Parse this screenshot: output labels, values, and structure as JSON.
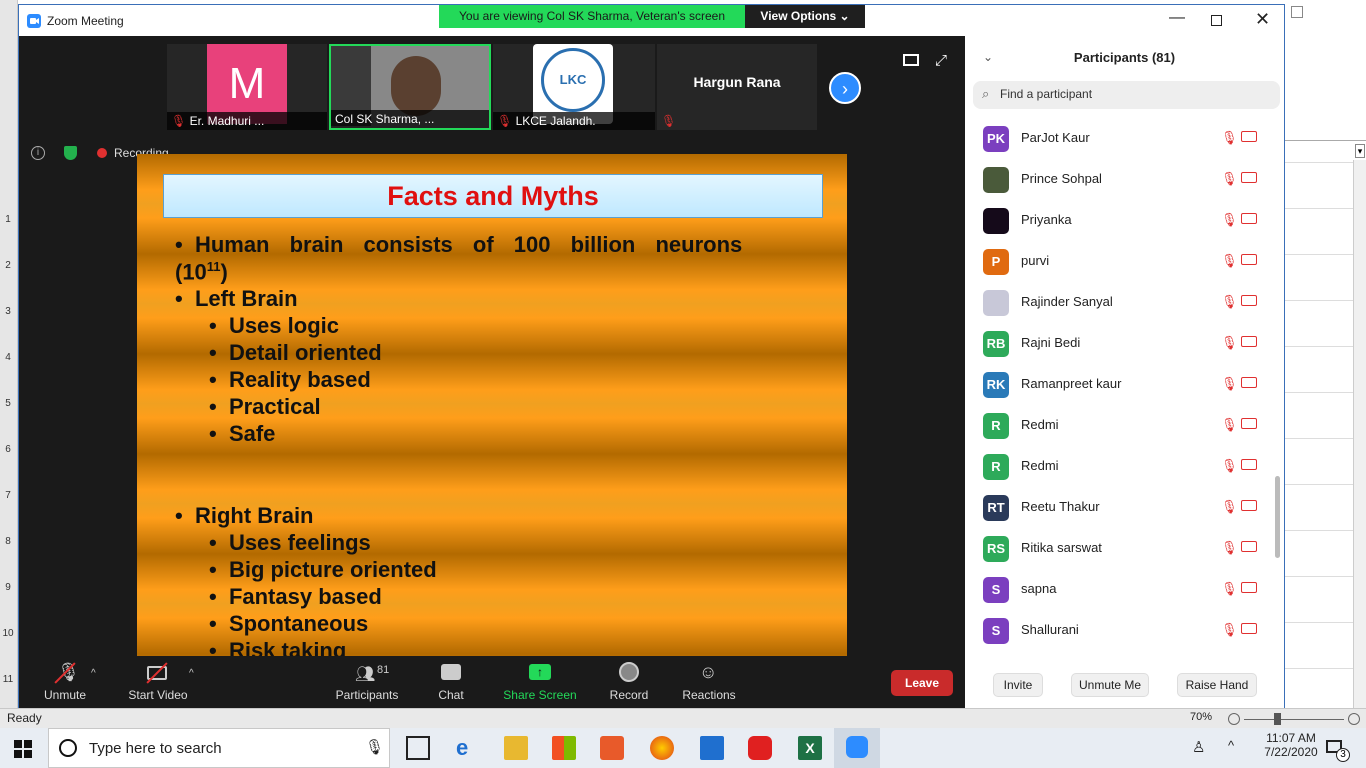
{
  "window": {
    "title": "Zoom Meeting"
  },
  "banner": {
    "text": "You are viewing Col SK Sharma, Veteran's screen",
    "view_options": "View Options"
  },
  "thumbnails": [
    {
      "label": "Er. Madhuri ...",
      "initial": "M"
    },
    {
      "label": "Col SK Sharma, ..."
    },
    {
      "label": "LKCE Jalandh.",
      "logo_text": "LKC"
    },
    {
      "label": "Hargun Rana"
    }
  ],
  "recording": {
    "text": "Recording"
  },
  "slide": {
    "title": "Facts and Myths",
    "line1": "Human brain consists of 100 billion neurons",
    "line1b": "(10",
    "line1_sup": "11",
    "line1_end": ")",
    "left_heading": "Left Brain",
    "left_items": [
      "Uses logic",
      "Detail oriented",
      "Reality based",
      "Practical",
      "Safe"
    ],
    "right_heading": "Right Brain",
    "right_items": [
      "Uses feelings",
      "Big picture oriented",
      "Fantasy based",
      "Spontaneous",
      "Risk taking"
    ]
  },
  "toolbar": {
    "unmute": "Unmute",
    "start_video": "Start Video",
    "participants": "Participants",
    "participants_count": "81",
    "chat": "Chat",
    "share_screen": "Share Screen",
    "record": "Record",
    "reactions": "Reactions",
    "leave": "Leave"
  },
  "panel": {
    "title": "Participants (81)",
    "search_placeholder": "Find a participant",
    "participants": [
      {
        "initials": "PK",
        "name": "ParJot Kaur",
        "color": "#7b3fbf"
      },
      {
        "initials": "",
        "name": "Prince Sohpal",
        "color": "#4a5a3a"
      },
      {
        "initials": "",
        "name": "Priyanka",
        "color": "#150a1a"
      },
      {
        "initials": "P",
        "name": "purvi",
        "color": "#e06a10"
      },
      {
        "initials": "",
        "name": "Rajinder Sanyal",
        "color": "#c8c8d8"
      },
      {
        "initials": "RB",
        "name": "Rajni Bedi",
        "color": "#2eaa5a"
      },
      {
        "initials": "RK",
        "name": "Ramanpreet kaur",
        "color": "#2a7ab8"
      },
      {
        "initials": "R",
        "name": "Redmi",
        "color": "#2eaa5a"
      },
      {
        "initials": "R",
        "name": "Redmi",
        "color": "#2eaa5a"
      },
      {
        "initials": "RT",
        "name": "Reetu Thakur",
        "color": "#2a3a5a"
      },
      {
        "initials": "RS",
        "name": "Ritika sarswat",
        "color": "#2eaa5a"
      },
      {
        "initials": "S",
        "name": "sapna",
        "color": "#7b3fbf"
      },
      {
        "initials": "S",
        "name": "Shallurani",
        "color": "#7b3fbf"
      }
    ],
    "invite": "Invite",
    "unmute_me": "Unmute Me",
    "raise_hand": "Raise Hand"
  },
  "excel": {
    "status": "Ready",
    "zoom": "70%",
    "rows": [
      "1",
      "2",
      "3",
      "4",
      "5",
      "6",
      "7",
      "8",
      "9",
      "10",
      "11"
    ]
  },
  "taskbar": {
    "search_placeholder": "Type here to search",
    "time": "11:07 AM",
    "date": "7/22/2020",
    "notif_count": "3"
  }
}
